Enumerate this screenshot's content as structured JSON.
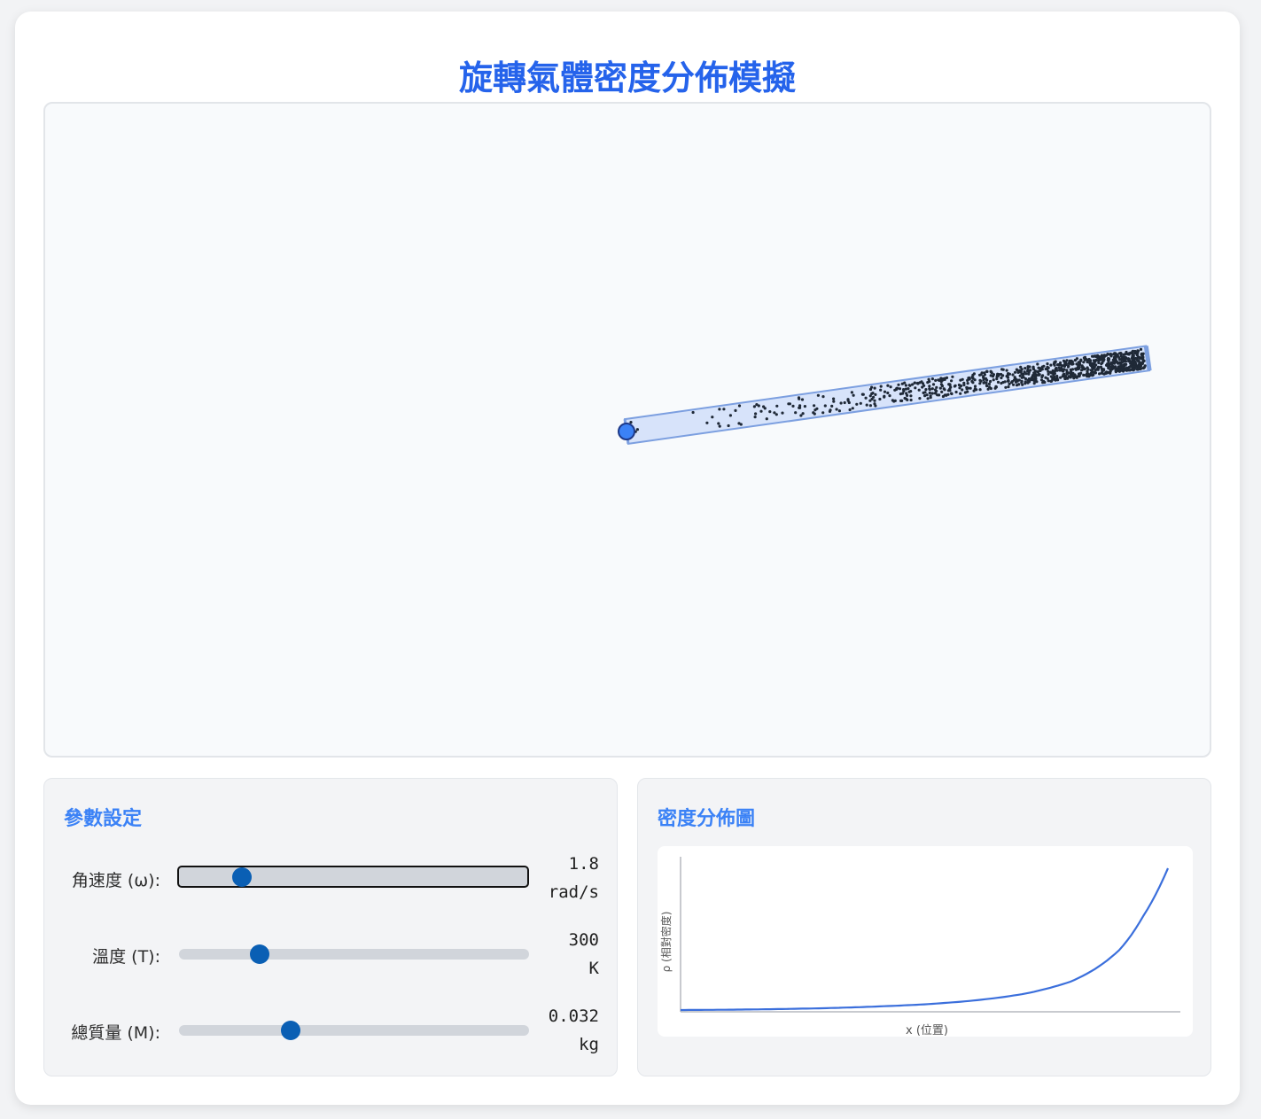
{
  "page": {
    "title": "旋轉氣體密度分佈模擬"
  },
  "simulation": {
    "tube_fill_color": "#d7e3fa",
    "tube_border_color": "#7c9fe0",
    "pivot_color": "#3b82f6",
    "particle_color": "#1f2937"
  },
  "controls": {
    "title": "參數設定",
    "sliders": [
      {
        "label": "角速度 (ω):",
        "value": "1.8",
        "unit": "rad/s",
        "fraction": 0.18,
        "focused": true
      },
      {
        "label": "溫度 (T):",
        "value": "300",
        "unit": "K",
        "fraction": 0.23,
        "focused": false
      },
      {
        "label": "總質量 (M):",
        "value": "0.032",
        "unit": "kg",
        "fraction": 0.32,
        "focused": false
      }
    ]
  },
  "density_panel": {
    "title": "密度分佈圖"
  },
  "chart_data": {
    "type": "line",
    "xlabel": "x (位置)",
    "ylabel": "ρ (相對密度)",
    "grid": false,
    "series": [
      {
        "color": "#3b6fdc",
        "x": [
          0,
          0.1,
          0.2,
          0.3,
          0.4,
          0.5,
          0.6,
          0.7,
          0.8,
          0.85,
          0.9,
          0.95,
          1.0
        ],
        "y": [
          0.0,
          0.002,
          0.006,
          0.012,
          0.022,
          0.036,
          0.06,
          0.1,
          0.18,
          0.26,
          0.38,
          0.6,
          0.9
        ]
      }
    ]
  }
}
